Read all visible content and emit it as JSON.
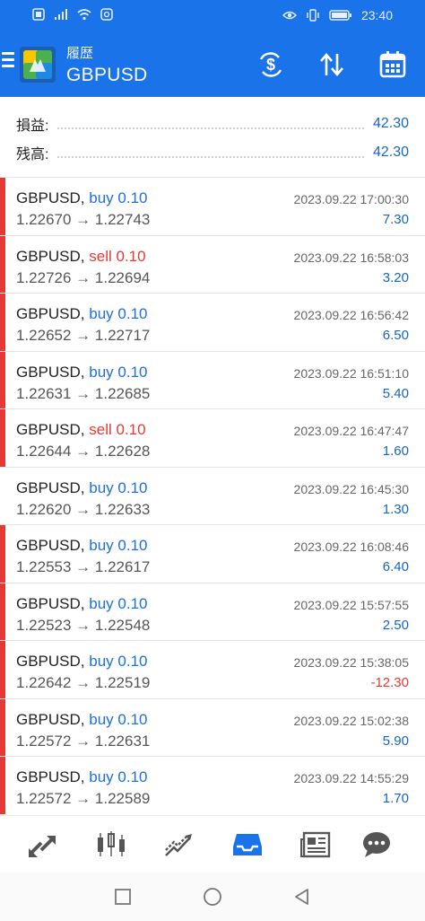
{
  "statusbar": {
    "left_icons": [
      "sim-icon",
      "signal-icon",
      "wifi-icon",
      "data-saver-icon"
    ],
    "right_icons": [
      "eye-icon",
      "vibrate-icon",
      "battery-icon"
    ],
    "time": "23:40"
  },
  "header": {
    "subtitle": "履歴",
    "title": "GBPUSD",
    "actions": [
      "dollar-refresh-icon",
      "sort-icon",
      "calendar-icon"
    ]
  },
  "summary": {
    "profit_label": "損益:",
    "profit_value": "42.30",
    "balance_label": "残高:",
    "balance_value": "42.30"
  },
  "trades": [
    {
      "symbol": "GBPUSD,",
      "type": "buy 0.10",
      "prices": "1.22670 → 1.22743",
      "time": "2023.09.22 17:00:30",
      "profit": "7.30"
    },
    {
      "symbol": "GBPUSD,",
      "type": "sell 0.10",
      "prices": "1.22726 → 1.22694",
      "time": "2023.09.22 16:58:03",
      "profit": "3.20"
    },
    {
      "symbol": "GBPUSD,",
      "type": "buy 0.10",
      "prices": "1.22652 → 1.22717",
      "time": "2023.09.22 16:56:42",
      "profit": "6.50"
    },
    {
      "symbol": "GBPUSD,",
      "type": "buy 0.10",
      "prices": "1.22631 → 1.22685",
      "time": "2023.09.22 16:51:10",
      "profit": "5.40"
    },
    {
      "symbol": "GBPUSD,",
      "type": "sell 0.10",
      "prices": "1.22644 → 1.22628",
      "time": "2023.09.22 16:47:47",
      "profit": "1.60"
    },
    {
      "symbol": "GBPUSD,",
      "type": "buy 0.10",
      "prices": "1.22620 → 1.22633",
      "time": "2023.09.22 16:45:30",
      "profit": "1.30"
    },
    {
      "symbol": "GBPUSD,",
      "type": "buy 0.10",
      "prices": "1.22553 → 1.22617",
      "time": "2023.09.22 16:08:46",
      "profit": "6.40"
    },
    {
      "symbol": "GBPUSD,",
      "type": "buy 0.10",
      "prices": "1.22523 → 1.22548",
      "time": "2023.09.22 15:57:55",
      "profit": "2.50"
    },
    {
      "symbol": "GBPUSD,",
      "type": "buy 0.10",
      "prices": "1.22642 → 1.22519",
      "time": "2023.09.22 15:38:05",
      "profit": "-12.30"
    },
    {
      "symbol": "GBPUSD,",
      "type": "buy 0.10",
      "prices": "1.22572 → 1.22631",
      "time": "2023.09.22 15:02:38",
      "profit": "5.90"
    },
    {
      "symbol": "GBPUSD,",
      "type": "buy 0.10",
      "prices": "1.22572 → 1.22589",
      "time": "2023.09.22 14:55:29",
      "profit": "1.70"
    }
  ],
  "bottom_nav": [
    "quotes-icon",
    "chart-candles-icon",
    "trade-icon",
    "history-inbox-icon",
    "news-icon",
    "chat-icon"
  ],
  "system_nav": [
    "recents-square-icon",
    "home-circle-icon",
    "back-triangle-icon"
  ],
  "colors": {
    "accent": "#1a73e8",
    "buy": "#1e6fd9",
    "sell": "#e53935",
    "profit": "#1565c0",
    "row_marker": "#e53935"
  }
}
